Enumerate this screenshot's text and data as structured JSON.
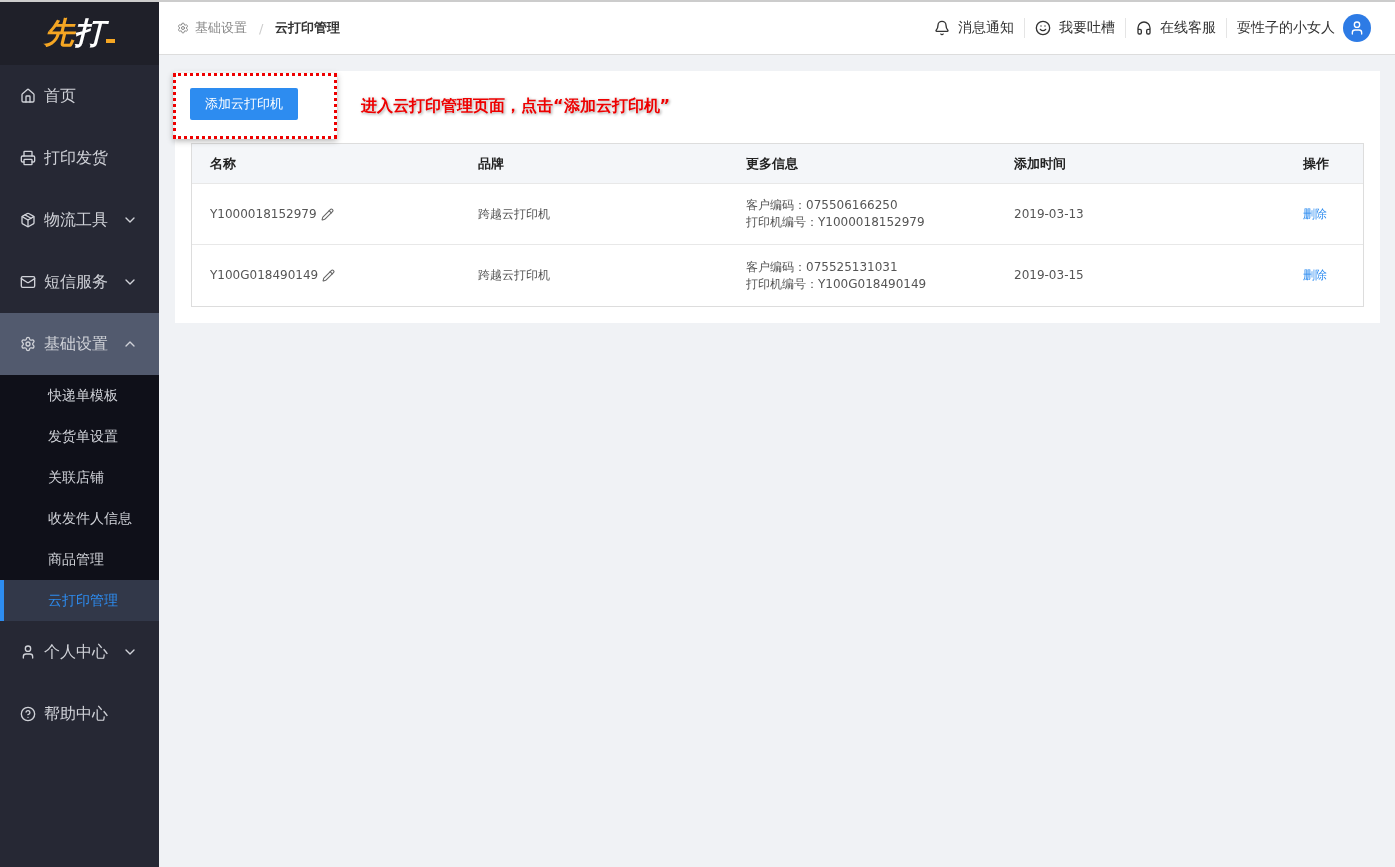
{
  "logo": [
    "先",
    "打"
  ],
  "sidebar": {
    "items": [
      {
        "kind": "link",
        "label": "首页"
      },
      {
        "kind": "link",
        "label": "打印发货"
      },
      {
        "kind": "group",
        "label": "物流工具",
        "expanded": false
      },
      {
        "kind": "group",
        "label": "短信服务",
        "expanded": false
      },
      {
        "kind": "group",
        "label": "基础设置",
        "expanded": true,
        "children": [
          {
            "label": "快递单模板",
            "selected": false
          },
          {
            "label": "发货单设置",
            "selected": false
          },
          {
            "label": "关联店铺",
            "selected": false
          },
          {
            "label": "收发件人信息",
            "selected": false
          },
          {
            "label": "商品管理",
            "selected": false
          },
          {
            "label": "云打印管理",
            "selected": true
          }
        ]
      },
      {
        "kind": "group",
        "label": "个人中心",
        "expanded": false
      },
      {
        "kind": "link",
        "label": "帮助中心"
      }
    ]
  },
  "breadcrumb": [
    "基础设置",
    "云打印管理"
  ],
  "breadcrumb_separator": "/",
  "header_links": [
    {
      "label": "消息通知"
    },
    {
      "label": "我要吐槽"
    },
    {
      "label": "在线客服"
    }
  ],
  "user": {
    "name": "耍性子的小女人"
  },
  "add_button": "添加云打印机",
  "annotation": "进入云打印管理页面，点击“添加云打印机”",
  "table": {
    "columns": [
      "名称",
      "品牌",
      "更多信息",
      "添加时间",
      "操作"
    ],
    "rows": [
      {
        "name": "Y1000018152979",
        "brand": "跨越云打印机",
        "info": [
          "客户编码：075506166250",
          "打印机编号：Y1000018152979"
        ],
        "date": "2019-03-13",
        "action": "删除"
      },
      {
        "name": "Y100G018490149",
        "brand": "跨越云打印机",
        "info": [
          "客户编码：075525131031",
          "打印机编号：Y100G018490149"
        ],
        "date": "2019-03-15",
        "action": "删除"
      }
    ]
  }
}
